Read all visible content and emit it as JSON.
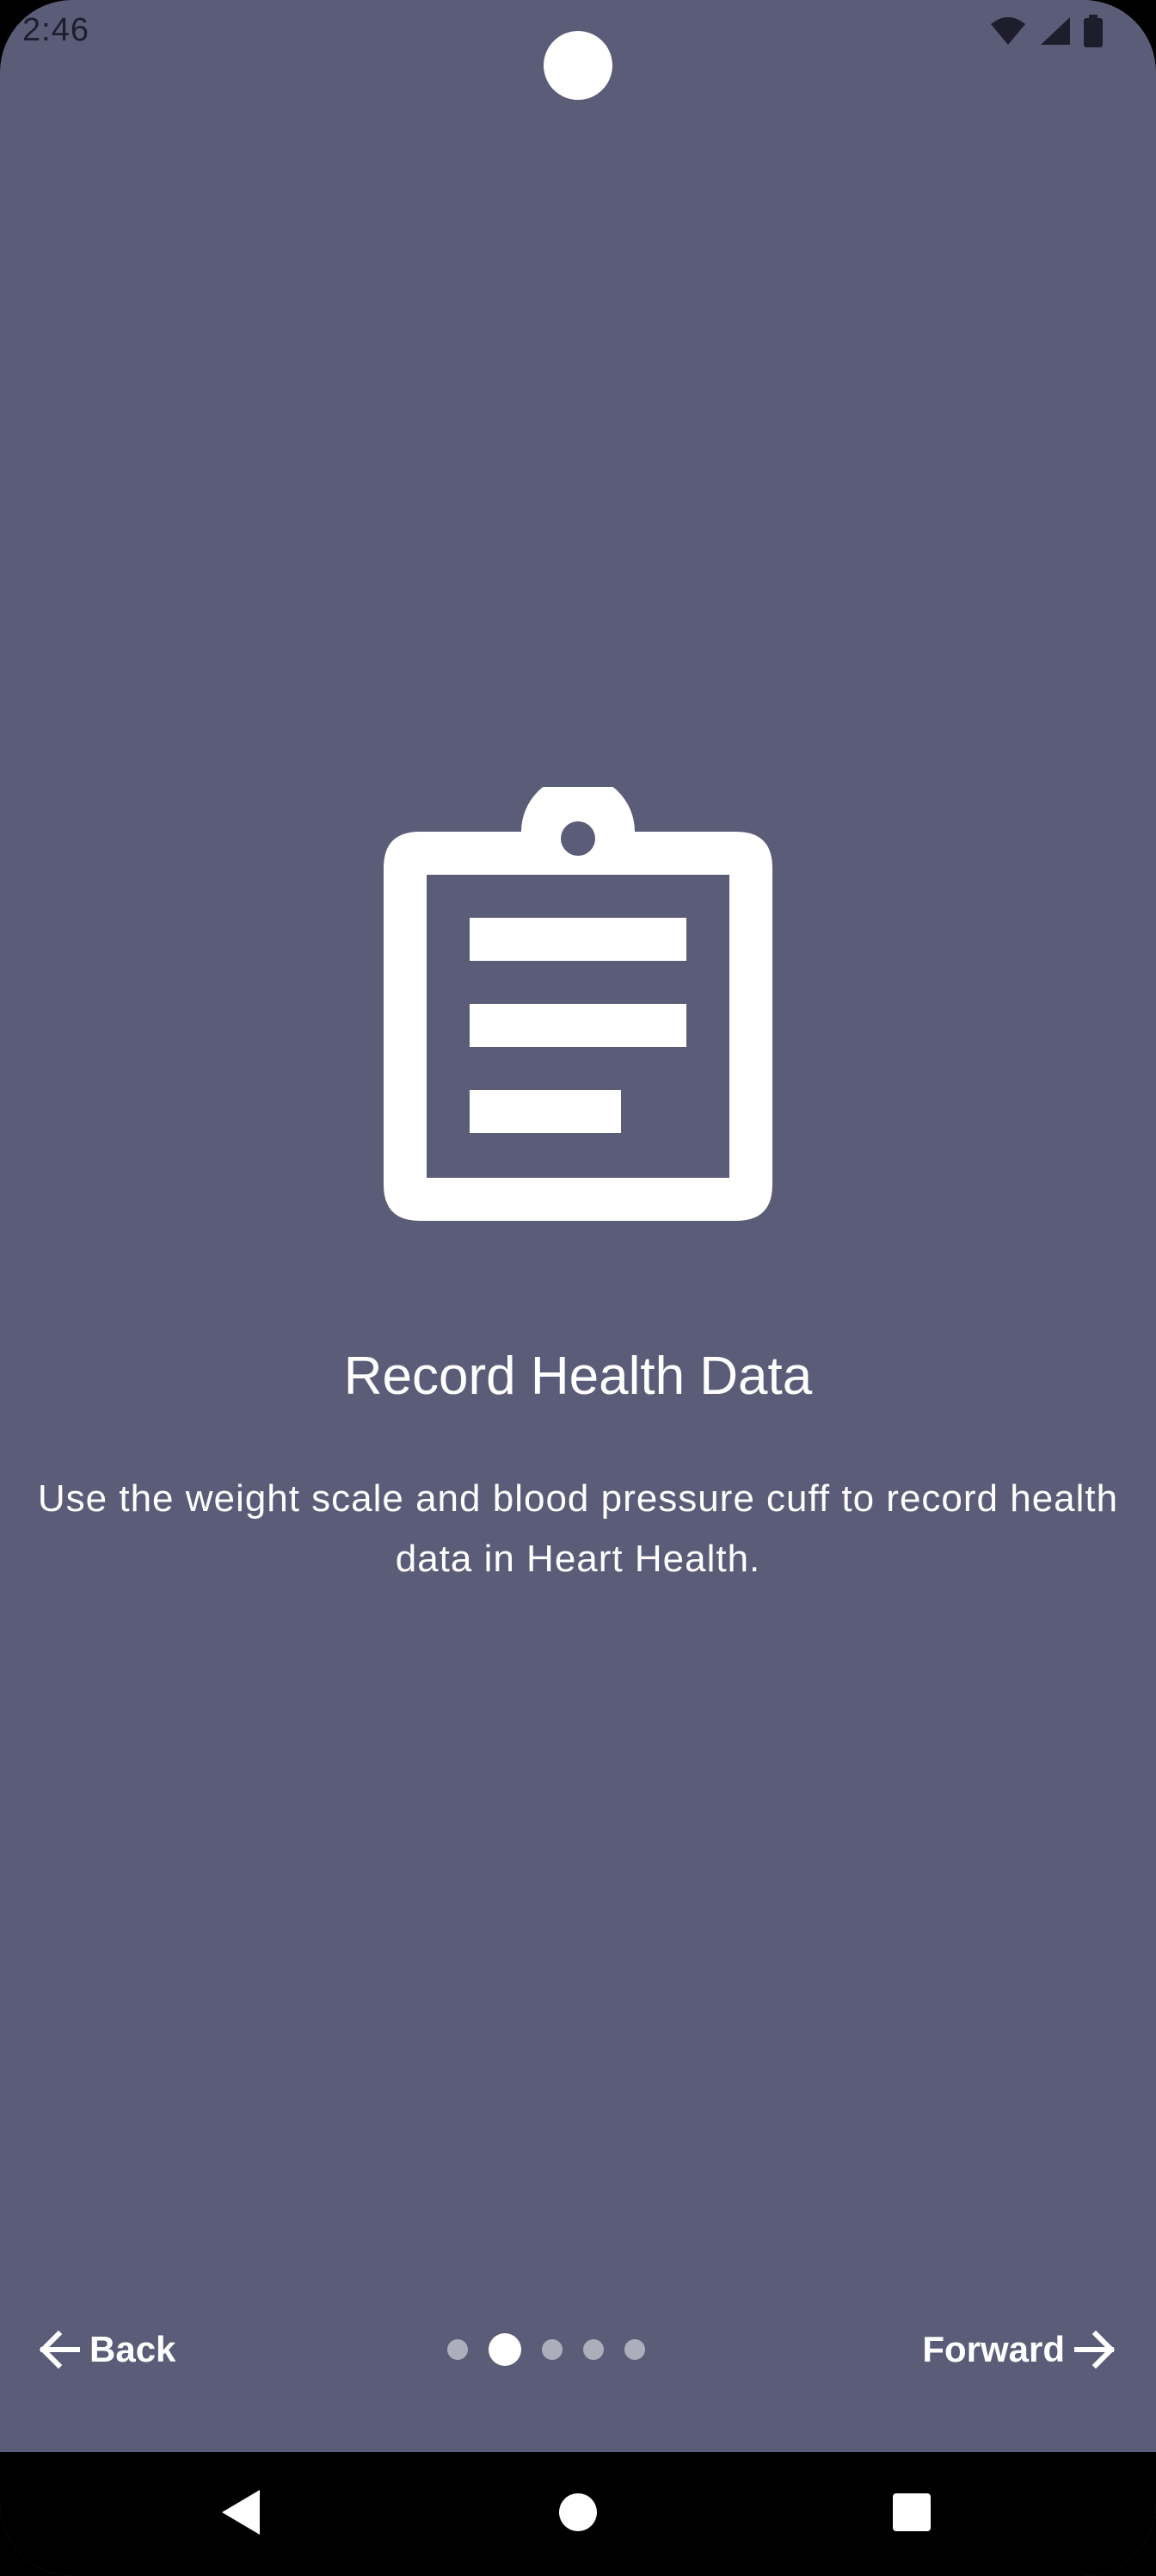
{
  "status_bar": {
    "time": "2:46",
    "icons": [
      "wifi-icon",
      "signal-icon",
      "battery-icon"
    ]
  },
  "onboarding": {
    "icon": "clipboard-icon",
    "title": "Record Health Data",
    "description": "Use the weight scale and blood pressure cuff to record health data in Heart Health.",
    "page_count": 5,
    "current_page": 2
  },
  "navigation": {
    "back_label": "Back",
    "forward_label": "Forward"
  },
  "system_nav": {
    "buttons": [
      "back-triangle-icon",
      "home-circle-icon",
      "recents-square-icon"
    ]
  },
  "colors": {
    "background": "#5b5c78",
    "foreground": "#ffffff",
    "system_bar": "#000000"
  }
}
